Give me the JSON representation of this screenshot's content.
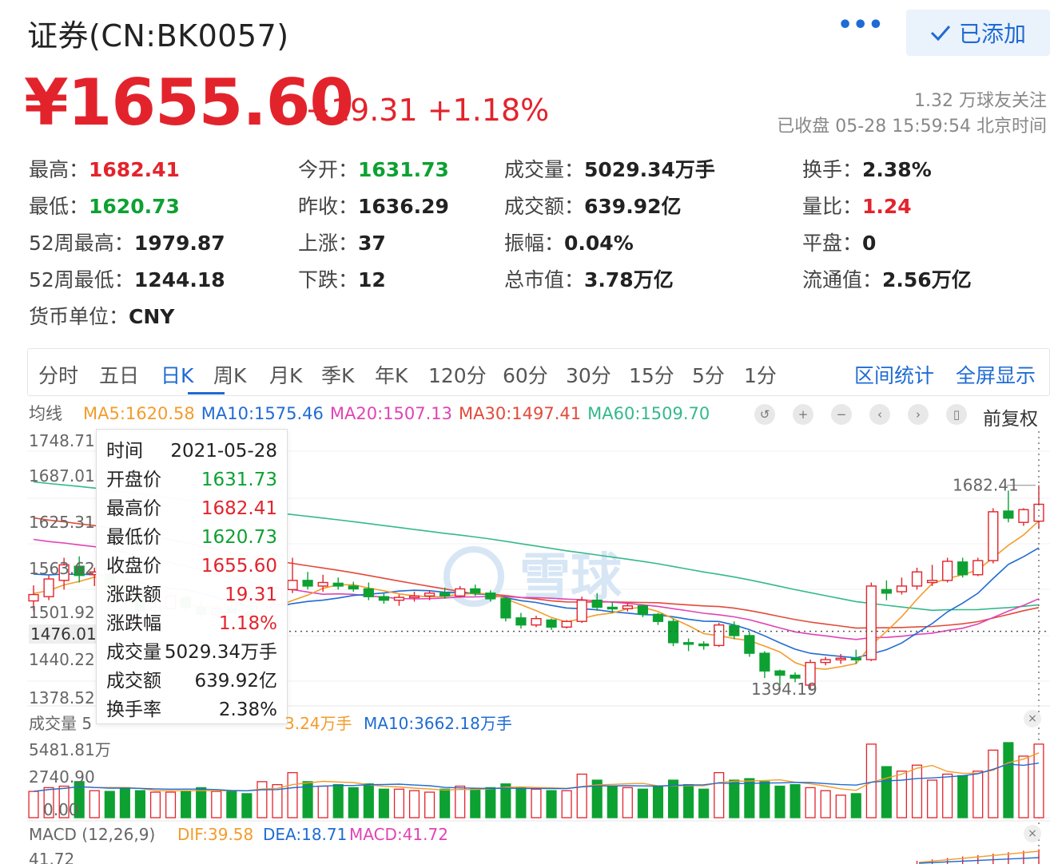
{
  "header": {
    "title": "证券(CN:BK0057)",
    "more_label": "•••",
    "added_label": "已添加",
    "price": "¥1655.60",
    "change": "+19.31 +1.18%",
    "followers": "1.32 万球友关注",
    "status": "已收盘 05-28 15:59:54 北京时间"
  },
  "quote": {
    "rows": [
      [
        {
          "label": "最高：",
          "value": "1682.41",
          "tone": "up"
        },
        {
          "label": "今开：",
          "value": "1631.73",
          "tone": "down"
        },
        {
          "label": "成交量：",
          "value": "5029.34万手",
          "tone": ""
        },
        {
          "label": "换手：",
          "value": "2.38%",
          "tone": ""
        }
      ],
      [
        {
          "label": "最低：",
          "value": "1620.73",
          "tone": "down"
        },
        {
          "label": "昨收：",
          "value": "1636.29",
          "tone": ""
        },
        {
          "label": "成交额：",
          "value": "639.92亿",
          "tone": ""
        },
        {
          "label": "量比：",
          "value": "1.24",
          "tone": "up"
        }
      ],
      [
        {
          "label": "52周最高：",
          "value": "1979.87",
          "tone": ""
        },
        {
          "label": "上涨：",
          "value": "37",
          "tone": ""
        },
        {
          "label": "振幅：",
          "value": "0.04%",
          "tone": ""
        },
        {
          "label": "平盘：",
          "value": "0",
          "tone": ""
        }
      ],
      [
        {
          "label": "52周最低：",
          "value": "1244.18",
          "tone": ""
        },
        {
          "label": "下跌：",
          "value": "12",
          "tone": ""
        },
        {
          "label": "总市值：",
          "value": "3.78万亿",
          "tone": ""
        },
        {
          "label": "流通值：",
          "value": "2.56万亿",
          "tone": ""
        }
      ],
      [
        {
          "label": "货币单位：",
          "value": "CNY",
          "tone": ""
        }
      ]
    ]
  },
  "tabs": {
    "items": [
      "分时",
      "五日",
      "日K",
      "周K",
      "月K",
      "季K",
      "年K",
      "120分",
      "60分",
      "30分",
      "15分",
      "5分",
      "1分"
    ],
    "active": "日K",
    "right": [
      "区间统计",
      "全屏显示"
    ]
  },
  "ma_bar": {
    "label": "均线",
    "items": [
      {
        "text": "MA5:1620.58",
        "color": "#f39c2b"
      },
      {
        "text": "MA10:1575.46",
        "color": "#1f6bd3"
      },
      {
        "text": "MA20:1507.13",
        "color": "#e044b5"
      },
      {
        "text": "MA30:1497.41",
        "color": "#e34a3a"
      },
      {
        "text": "MA60:1509.70",
        "color": "#34b98a"
      }
    ],
    "adjust_label": "前复权"
  },
  "tooltip": [
    {
      "label": "时间",
      "value": "2021-05-28",
      "tone": ""
    },
    {
      "label": "开盘价",
      "value": "1631.73",
      "tone": "down"
    },
    {
      "label": "最高价",
      "value": "1682.41",
      "tone": "up"
    },
    {
      "label": "最低价",
      "value": "1620.73",
      "tone": "down"
    },
    {
      "label": "收盘价",
      "value": "1655.60",
      "tone": "up"
    },
    {
      "label": "涨跌额",
      "value": "19.31",
      "tone": "up"
    },
    {
      "label": "涨跌幅",
      "value": "1.18%",
      "tone": "up"
    },
    {
      "label": "成交量",
      "value": "5029.34万手",
      "tone": ""
    },
    {
      "label": "成交额",
      "value": "639.92亿",
      "tone": ""
    },
    {
      "label": "换手率",
      "value": "2.38%",
      "tone": ""
    }
  ],
  "price_axis": [
    "1748.71",
    "1687.01",
    "1625.31",
    "1563.62",
    "1501.92",
    "1476.01",
    "1440.22",
    "1378.52"
  ],
  "price_marks": {
    "high": "1682.41",
    "low": "1394.19"
  },
  "watermark": "雪球",
  "volume": {
    "label": "成交量 5",
    "ma5": "3.24万手",
    "ma10": "MA10:3662.18万手",
    "axis": [
      "5481.81万",
      "2740.90",
      "0.00"
    ]
  },
  "macd": {
    "label": "MACD (12,26,9)",
    "dif": "DIF:39.58",
    "dea": "DEA:18.71",
    "macd": "MACD:41.72",
    "axis_top": "41.72"
  },
  "colors": {
    "up": "#e3232c",
    "down": "#0da132",
    "accent": "#1f6bd3"
  },
  "chart_data": {
    "type": "candlestick",
    "x": [
      "2021-05-28"
    ],
    "candles": [
      {
        "o": 1519,
        "h": 1541,
        "l": 1505,
        "c": 1528
      },
      {
        "o": 1525,
        "h": 1555,
        "l": 1520,
        "c": 1550
      },
      {
        "o": 1548,
        "h": 1580,
        "l": 1535,
        "c": 1570
      },
      {
        "o": 1568,
        "h": 1582,
        "l": 1545,
        "c": 1555
      },
      {
        "o": 1556,
        "h": 1566,
        "l": 1540,
        "c": 1560
      },
      {
        "o": 1558,
        "h": 1572,
        "l": 1530,
        "c": 1538
      },
      {
        "o": 1537,
        "h": 1545,
        "l": 1518,
        "c": 1524
      },
      {
        "o": 1523,
        "h": 1530,
        "l": 1500,
        "c": 1505
      },
      {
        "o": 1505,
        "h": 1515,
        "l": 1490,
        "c": 1510
      },
      {
        "o": 1508,
        "h": 1530,
        "l": 1505,
        "c": 1526
      },
      {
        "o": 1524,
        "h": 1528,
        "l": 1505,
        "c": 1510
      },
      {
        "o": 1510,
        "h": 1518,
        "l": 1495,
        "c": 1500
      },
      {
        "o": 1500,
        "h": 1512,
        "l": 1496,
        "c": 1508
      },
      {
        "o": 1508,
        "h": 1514,
        "l": 1500,
        "c": 1502
      },
      {
        "o": 1502,
        "h": 1506,
        "l": 1490,
        "c": 1497
      },
      {
        "o": 1497,
        "h": 1518,
        "l": 1495,
        "c": 1515
      },
      {
        "o": 1514,
        "h": 1540,
        "l": 1512,
        "c": 1536
      },
      {
        "o": 1535,
        "h": 1580,
        "l": 1530,
        "c": 1548
      },
      {
        "o": 1548,
        "h": 1560,
        "l": 1535,
        "c": 1540
      },
      {
        "o": 1540,
        "h": 1556,
        "l": 1532,
        "c": 1545
      },
      {
        "o": 1544,
        "h": 1552,
        "l": 1535,
        "c": 1540
      },
      {
        "o": 1540,
        "h": 1546,
        "l": 1532,
        "c": 1536
      },
      {
        "o": 1536,
        "h": 1545,
        "l": 1520,
        "c": 1525
      },
      {
        "o": 1525,
        "h": 1530,
        "l": 1515,
        "c": 1520
      },
      {
        "o": 1520,
        "h": 1528,
        "l": 1512,
        "c": 1524
      },
      {
        "o": 1524,
        "h": 1532,
        "l": 1518,
        "c": 1526
      },
      {
        "o": 1526,
        "h": 1534,
        "l": 1520,
        "c": 1530
      },
      {
        "o": 1530,
        "h": 1538,
        "l": 1522,
        "c": 1526
      },
      {
        "o": 1526,
        "h": 1540,
        "l": 1524,
        "c": 1536
      },
      {
        "o": 1536,
        "h": 1542,
        "l": 1526,
        "c": 1530
      },
      {
        "o": 1530,
        "h": 1534,
        "l": 1518,
        "c": 1522
      },
      {
        "o": 1522,
        "h": 1524,
        "l": 1490,
        "c": 1495
      },
      {
        "o": 1495,
        "h": 1502,
        "l": 1480,
        "c": 1485
      },
      {
        "o": 1485,
        "h": 1498,
        "l": 1482,
        "c": 1494
      },
      {
        "o": 1492,
        "h": 1494,
        "l": 1478,
        "c": 1482
      },
      {
        "o": 1482,
        "h": 1492,
        "l": 1480,
        "c": 1490
      },
      {
        "o": 1490,
        "h": 1525,
        "l": 1488,
        "c": 1520
      },
      {
        "o": 1520,
        "h": 1530,
        "l": 1505,
        "c": 1510
      },
      {
        "o": 1510,
        "h": 1518,
        "l": 1502,
        "c": 1508
      },
      {
        "o": 1508,
        "h": 1516,
        "l": 1504,
        "c": 1512
      },
      {
        "o": 1512,
        "h": 1514,
        "l": 1496,
        "c": 1500
      },
      {
        "o": 1500,
        "h": 1502,
        "l": 1485,
        "c": 1490
      },
      {
        "o": 1490,
        "h": 1494,
        "l": 1455,
        "c": 1460
      },
      {
        "o": 1460,
        "h": 1466,
        "l": 1448,
        "c": 1458
      },
      {
        "o": 1458,
        "h": 1462,
        "l": 1450,
        "c": 1456
      },
      {
        "o": 1456,
        "h": 1488,
        "l": 1454,
        "c": 1485
      },
      {
        "o": 1484,
        "h": 1490,
        "l": 1465,
        "c": 1470
      },
      {
        "o": 1470,
        "h": 1475,
        "l": 1440,
        "c": 1445
      },
      {
        "o": 1445,
        "h": 1448,
        "l": 1410,
        "c": 1420
      },
      {
        "o": 1420,
        "h": 1422,
        "l": 1400,
        "c": 1414
      },
      {
        "o": 1414,
        "h": 1418,
        "l": 1404,
        "c": 1410
      },
      {
        "o": 1400,
        "h": 1436,
        "l": 1394.19,
        "c": 1432
      },
      {
        "o": 1432,
        "h": 1440,
        "l": 1428,
        "c": 1436
      },
      {
        "o": 1436,
        "h": 1444,
        "l": 1430,
        "c": 1438
      },
      {
        "o": 1438,
        "h": 1450,
        "l": 1430,
        "c": 1436
      },
      {
        "o": 1436,
        "h": 1545,
        "l": 1434,
        "c": 1540
      },
      {
        "o": 1535,
        "h": 1548,
        "l": 1520,
        "c": 1530
      },
      {
        "o": 1532,
        "h": 1552,
        "l": 1528,
        "c": 1540
      },
      {
        "o": 1540,
        "h": 1566,
        "l": 1535,
        "c": 1560
      },
      {
        "o": 1545,
        "h": 1570,
        "l": 1540,
        "c": 1548
      },
      {
        "o": 1548,
        "h": 1580,
        "l": 1545,
        "c": 1575
      },
      {
        "o": 1574,
        "h": 1580,
        "l": 1552,
        "c": 1556
      },
      {
        "o": 1556,
        "h": 1580,
        "l": 1554,
        "c": 1576
      },
      {
        "o": 1576,
        "h": 1650,
        "l": 1572,
        "c": 1645
      },
      {
        "o": 1646,
        "h": 1675,
        "l": 1630,
        "c": 1636
      },
      {
        "o": 1630,
        "h": 1650,
        "l": 1625,
        "c": 1648
      },
      {
        "o": 1631.73,
        "h": 1682.41,
        "l": 1620.73,
        "c": 1655.6
      }
    ],
    "ma_latest": {
      "MA5": 1620.58,
      "MA10": 1575.46,
      "MA20": 1507.13,
      "MA30": 1497.41,
      "MA60": 1509.7
    },
    "ylim": [
      1378.52,
      1748.71
    ]
  }
}
